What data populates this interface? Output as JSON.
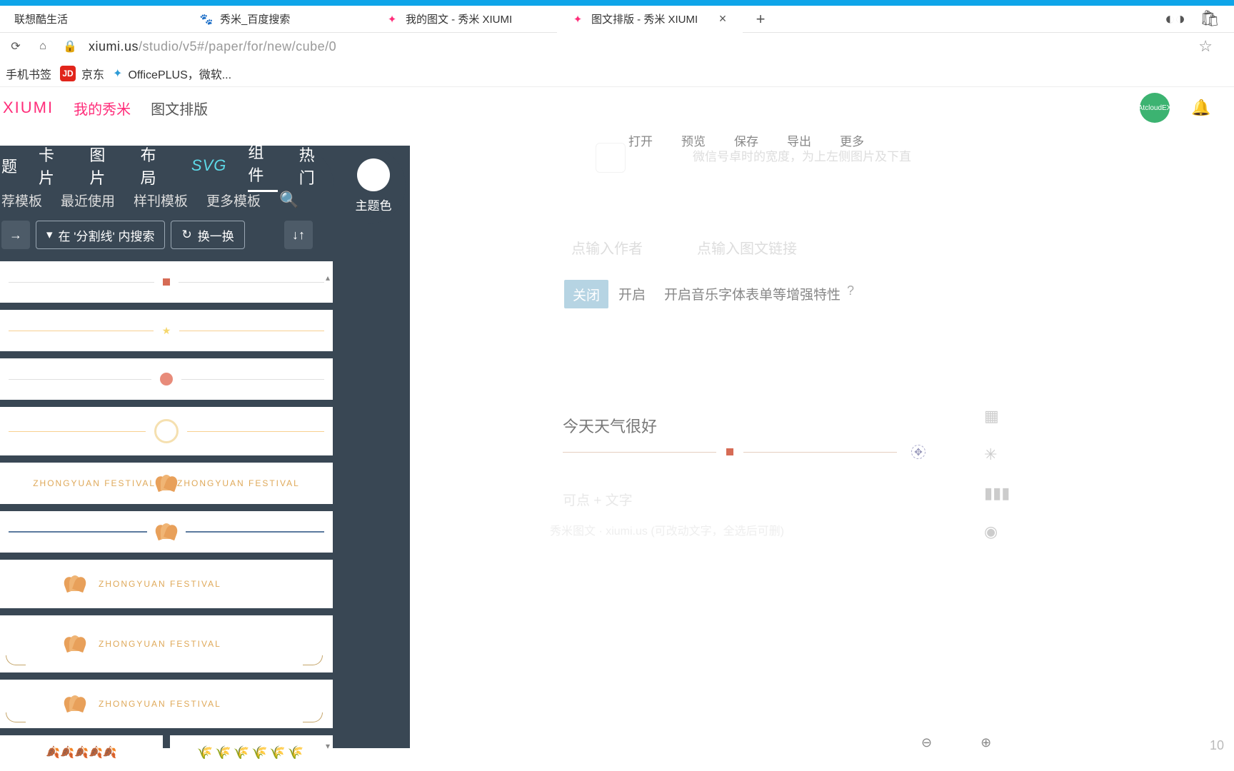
{
  "browser": {
    "tabs": [
      {
        "title": "联想酷生活"
      },
      {
        "title": "秀米_百度搜索"
      },
      {
        "title": "我的图文 - 秀米 XIUMI"
      },
      {
        "title": "图文排版 - 秀米 XIUMI"
      }
    ],
    "url_host": "xiumi.us",
    "url_path": "/studio/v5#/paper/for/new/cube/0",
    "bookmarks": {
      "mobile": "手机书签",
      "jd": "京东",
      "jd_icon": "JD",
      "office": "OfficePLUS，微软..."
    }
  },
  "app": {
    "brand": "XIUMI",
    "nav_my": "我的秀米",
    "nav_paper": "图文排版",
    "avatar_text": "AtcloudEX",
    "theme_label": "主题色"
  },
  "cats": {
    "title": "题",
    "card": "卡片",
    "image": "图片",
    "layout": "布局",
    "svg": "SVG",
    "component": "组件",
    "hot": "热门"
  },
  "subcats": {
    "rec": "荐模板",
    "recent": "最近使用",
    "sample": "样刊模板",
    "more": "更多模板"
  },
  "tools": {
    "expand": "→",
    "filter_label": "在 '分割线' 内搜索",
    "shuffle_label": "换一换",
    "sort": "↓↑"
  },
  "tpl": {
    "zh_fest": "ZHONGYUAN  FESTIVAL"
  },
  "editor": {
    "menu_open": "打开",
    "menu_preview": "预览",
    "menu_save": "保存",
    "menu_export": "导出",
    "menu_more": "更多",
    "cover_hint": "微信号卓时的宽度，为上左侧图片及下直",
    "author_ph": "点输入作者",
    "link_ph": "点输入图文链接",
    "toggle_off": "关闭",
    "toggle_on": "开启",
    "enhance": "开启音乐字体表单等增强特性",
    "help": "?",
    "canvas_title": "今天天气很好",
    "canvas_ph": "可点 + 文字",
    "canvas_credit": "秀米图文 · xiumi.us  (可改动文字，全选后可删)",
    "handle": "✥"
  },
  "zoom": {
    "value": "10"
  }
}
